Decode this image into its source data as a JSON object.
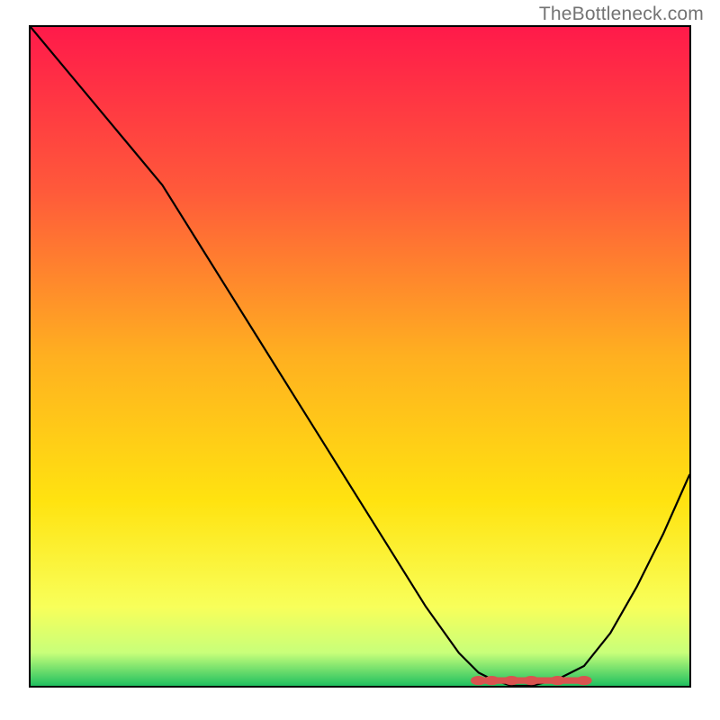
{
  "watermark": "TheBottleneck.com",
  "chart_data": {
    "type": "line",
    "title": "",
    "xlabel": "",
    "ylabel": "",
    "xlim": [
      0,
      100
    ],
    "ylim": [
      0,
      100
    ],
    "series": [
      {
        "name": "curve",
        "x": [
          0,
          5,
          10,
          15,
          20,
          25,
          30,
          35,
          40,
          45,
          50,
          55,
          60,
          65,
          68,
          70,
          73,
          76,
          80,
          84,
          88,
          92,
          96,
          100
        ],
        "y": [
          100,
          94,
          88,
          82,
          76,
          68,
          60,
          52,
          44,
          36,
          28,
          20,
          12,
          5,
          2,
          1,
          0,
          0,
          1,
          3,
          8,
          15,
          23,
          32
        ]
      }
    ],
    "markers": {
      "name": "optimal-region",
      "color": "#d9534f",
      "x": [
        68,
        70,
        73,
        76,
        80,
        84
      ],
      "y": [
        0.5,
        0.5,
        0.5,
        0.5,
        0.5,
        0.5
      ]
    },
    "background": {
      "type": "vertical-gradient",
      "stops": [
        {
          "offset": 0,
          "color": "#ff1a4a"
        },
        {
          "offset": 0.25,
          "color": "#ff5a3a"
        },
        {
          "offset": 0.5,
          "color": "#ffb020"
        },
        {
          "offset": 0.72,
          "color": "#ffe310"
        },
        {
          "offset": 0.88,
          "color": "#f8ff5a"
        },
        {
          "offset": 0.95,
          "color": "#c8ff7a"
        },
        {
          "offset": 1.0,
          "color": "#20c060"
        }
      ]
    }
  }
}
